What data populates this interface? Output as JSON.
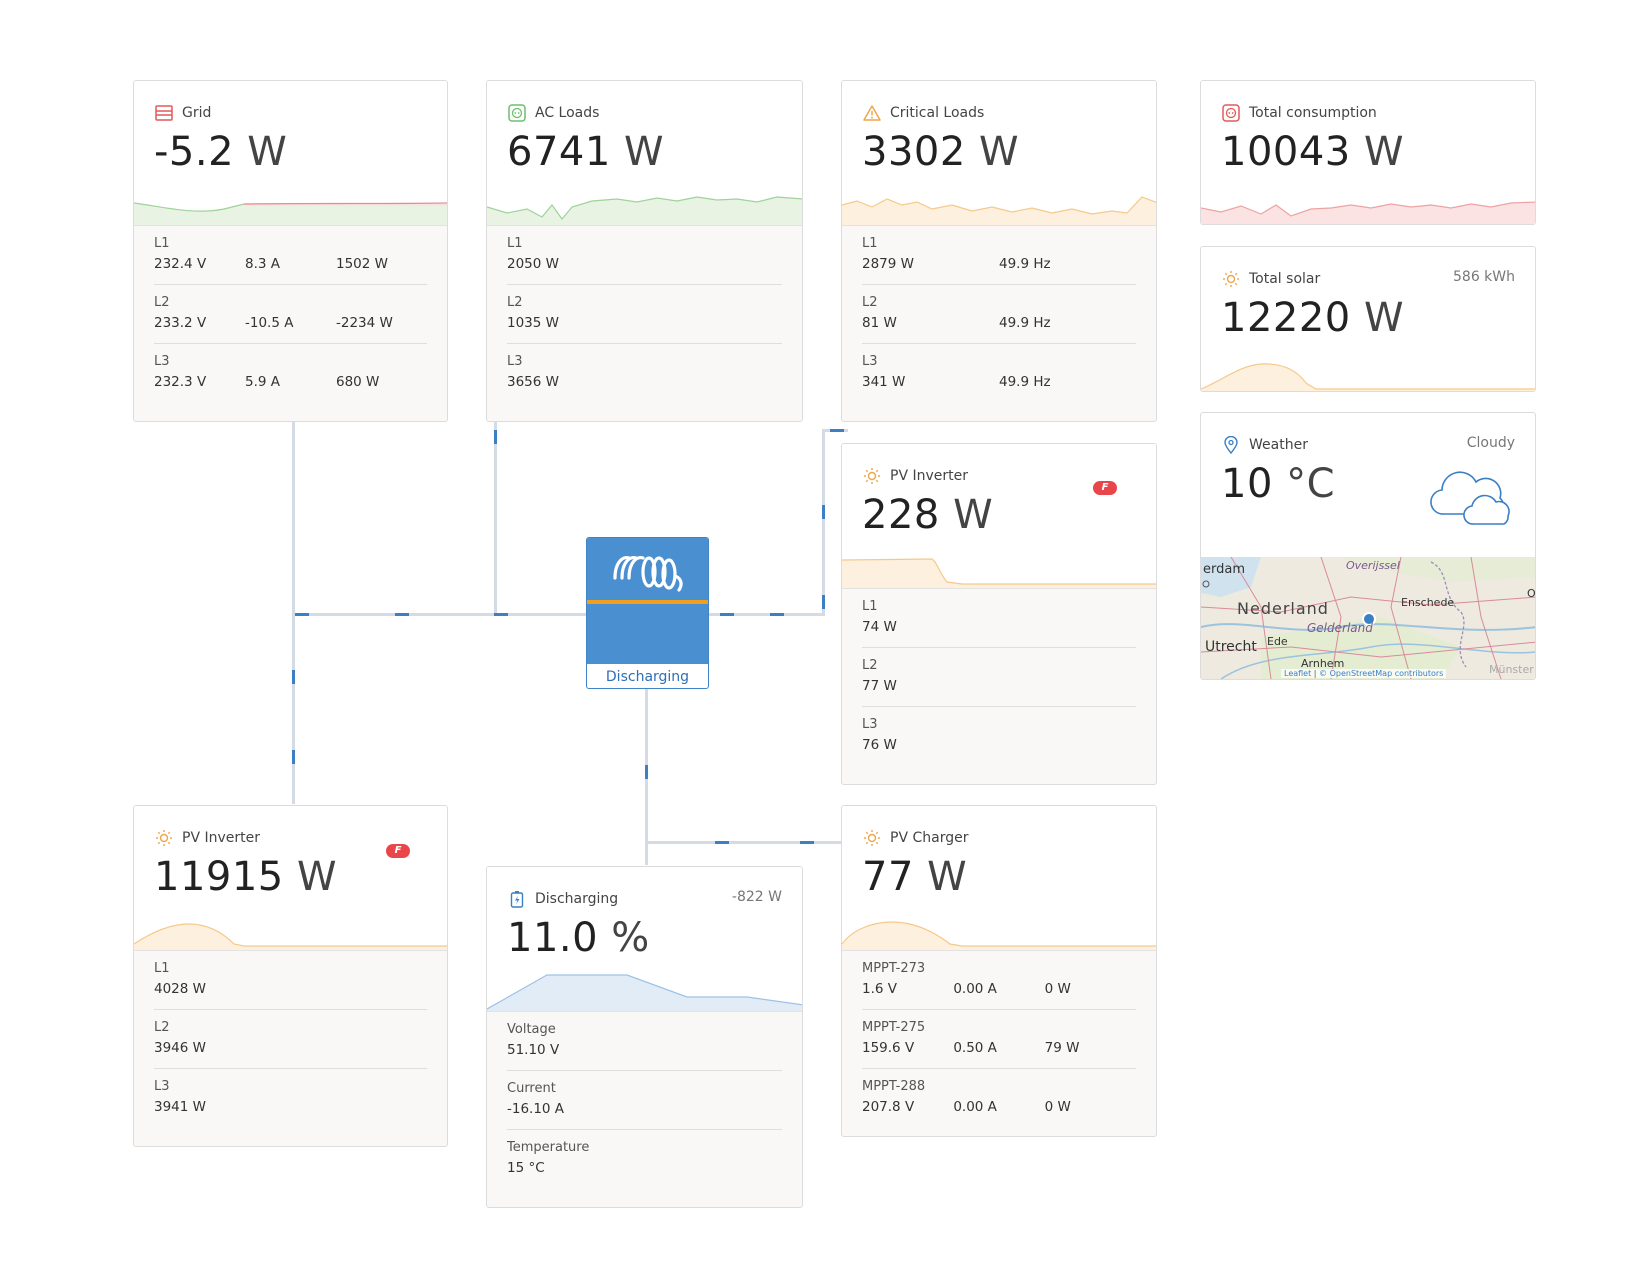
{
  "grid": {
    "title": "Grid",
    "value": "-5.2",
    "unit": "W",
    "rows": [
      {
        "label": "L1",
        "v1": "232.4 V",
        "v2": "8.3 A",
        "v3": "1502 W"
      },
      {
        "label": "L2",
        "v1": "233.2 V",
        "v2": "-10.5 A",
        "v3": "-2234 W"
      },
      {
        "label": "L3",
        "v1": "232.3 V",
        "v2": "5.9 A",
        "v3": "680 W"
      }
    ]
  },
  "ac_loads": {
    "title": "AC Loads",
    "value": "6741",
    "unit": "W",
    "rows": [
      {
        "label": "L1",
        "v1": "2050 W"
      },
      {
        "label": "L2",
        "v1": "1035 W"
      },
      {
        "label": "L3",
        "v1": "3656 W"
      }
    ]
  },
  "critical_loads": {
    "title": "Critical Loads",
    "value": "3302",
    "unit": "W",
    "rows": [
      {
        "label": "L1",
        "v1": "2879 W",
        "v2": "49.9 Hz"
      },
      {
        "label": "L2",
        "v1": "81 W",
        "v2": "49.9 Hz"
      },
      {
        "label": "L3",
        "v1": "341 W",
        "v2": "49.9 Hz"
      }
    ]
  },
  "total_consumption": {
    "title": "Total consumption",
    "value": "10043",
    "unit": "W"
  },
  "total_solar": {
    "title": "Total solar",
    "right": "586 kWh",
    "value": "12220",
    "unit": "W"
  },
  "weather": {
    "title": "Weather",
    "right": "Cloudy",
    "value": "10",
    "unit": "°C",
    "map_labels": [
      "erdam",
      "Overijssel",
      "Nederland",
      "Enschede",
      "Gelderland",
      "Utrecht",
      "Ede",
      "Arnhem",
      "Münster",
      "O"
    ],
    "attribution_leaflet": "Leaflet",
    "attribution_sep": "|",
    "attribution_osm": "© OpenStreetMap contributors"
  },
  "pv_inverter_right": {
    "title": "PV Inverter",
    "value": "228",
    "unit": "W",
    "rows": [
      {
        "label": "L1",
        "v1": "74 W"
      },
      {
        "label": "L2",
        "v1": "77 W"
      },
      {
        "label": "L3",
        "v1": "76 W"
      }
    ]
  },
  "inverter": {
    "status": "Discharging"
  },
  "pv_inverter_left": {
    "title": "PV Inverter",
    "value": "11915",
    "unit": "W",
    "rows": [
      {
        "label": "L1",
        "v1": "4028 W"
      },
      {
        "label": "L2",
        "v1": "3946 W"
      },
      {
        "label": "L3",
        "v1": "3941 W"
      }
    ]
  },
  "battery": {
    "title": "Discharging",
    "right": "-822 W",
    "value": "11.0",
    "unit": "%",
    "rows": [
      {
        "label": "Voltage",
        "v1": "51.10 V"
      },
      {
        "label": "Current",
        "v1": "-16.10 A"
      },
      {
        "label": "Temperature",
        "v1": "15 °C"
      }
    ]
  },
  "pv_charger": {
    "title": "PV Charger",
    "value": "77",
    "unit": "W",
    "rows": [
      {
        "label": "MPPT-273",
        "v1": "1.6 V",
        "v2": "0.00 A",
        "v3": "0 W"
      },
      {
        "label": "MPPT-275",
        "v1": "159.6 V",
        "v2": "0.50 A",
        "v3": "79 W"
      },
      {
        "label": "MPPT-288",
        "v1": "207.8 V",
        "v2": "0.00 A",
        "v3": "0 W"
      }
    ]
  },
  "colors": {
    "grid": "#e05a5a",
    "ac": "#6cbf6c",
    "critical": "#f0a64a",
    "solar": "#f0a64a",
    "battery": "#3b7fc4",
    "accent_blue": "#4a8fd0"
  }
}
